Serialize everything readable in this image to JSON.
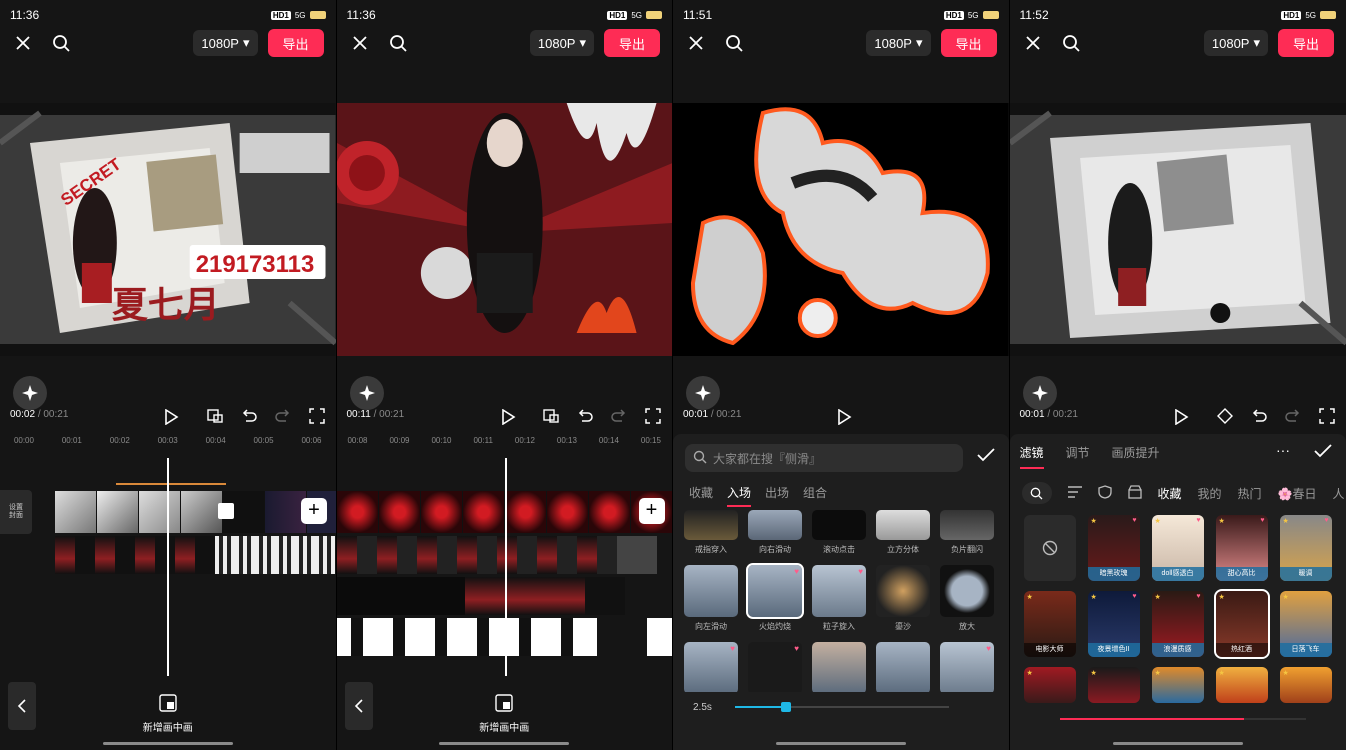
{
  "colors": {
    "accent": "#fe2c55",
    "highlight": "#1fb8e6",
    "bg": "#151515"
  },
  "screens": [
    {
      "status": {
        "time": "11:36",
        "net": "5G"
      },
      "resolution": "1080P",
      "export_label": "导出",
      "preview": {
        "badge_number": "219173113",
        "title_text": "夏七月",
        "stamp": "SECRET"
      },
      "timecode": {
        "current": "00:02",
        "total": "/ 00:21"
      },
      "ruler": [
        "00:00",
        "00:01",
        "00:02",
        "00:03",
        "00:04",
        "00:05",
        "00:06"
      ],
      "cover_label": "设置\n封面",
      "pip_label": "新增画中画"
    },
    {
      "status": {
        "time": "11:36",
        "net": "5G"
      },
      "resolution": "1080P",
      "export_label": "导出",
      "timecode": {
        "current": "00:11",
        "total": "/ 00:21"
      },
      "ruler": [
        "00:08",
        "00:09",
        "00:10",
        "00:11",
        "00:12",
        "00:13",
        "00:14",
        "00:15"
      ],
      "pip_label": "新增画中画"
    },
    {
      "status": {
        "time": "11:51",
        "net": "5G"
      },
      "resolution": "1080P",
      "export_label": "导出",
      "timecode": {
        "current": "00:01",
        "total": "/ 00:21"
      },
      "search_placeholder": "大家都在搜『侧滑』",
      "tabs": [
        "收藏",
        "入场",
        "出场",
        "组合"
      ],
      "active_tab": "入场",
      "row1": [
        "戒指穿入",
        "向右滑动",
        "滚动点击",
        "立方分体",
        "负片翻闪"
      ],
      "row2": [
        "向左滑动",
        "火焰灼烧",
        "粒子旋入",
        "鎏沙",
        "放大"
      ],
      "selected": "火焰灼烧",
      "duration": "2.5s",
      "duration_fraction": 0.24
    },
    {
      "status": {
        "time": "11:52",
        "net": "5G"
      },
      "resolution": "1080P",
      "export_label": "导出",
      "timecode": {
        "current": "00:01",
        "total": "/ 00:21"
      },
      "tabs": [
        "滤镜",
        "调节",
        "画质提升"
      ],
      "active_tab": "滤镜",
      "categories": [
        "收藏",
        "我的",
        "热门",
        "🌸春日",
        "人"
      ],
      "active_category": "收藏",
      "row1": [
        "",
        "暗黑玫瑰",
        "doll感透白",
        "甜心高比",
        "暖调"
      ],
      "row2": [
        "电影大师",
        "夜景增色II",
        "浪漫质感",
        "热红酒",
        "日落飞车"
      ],
      "selected": "热红酒"
    }
  ]
}
